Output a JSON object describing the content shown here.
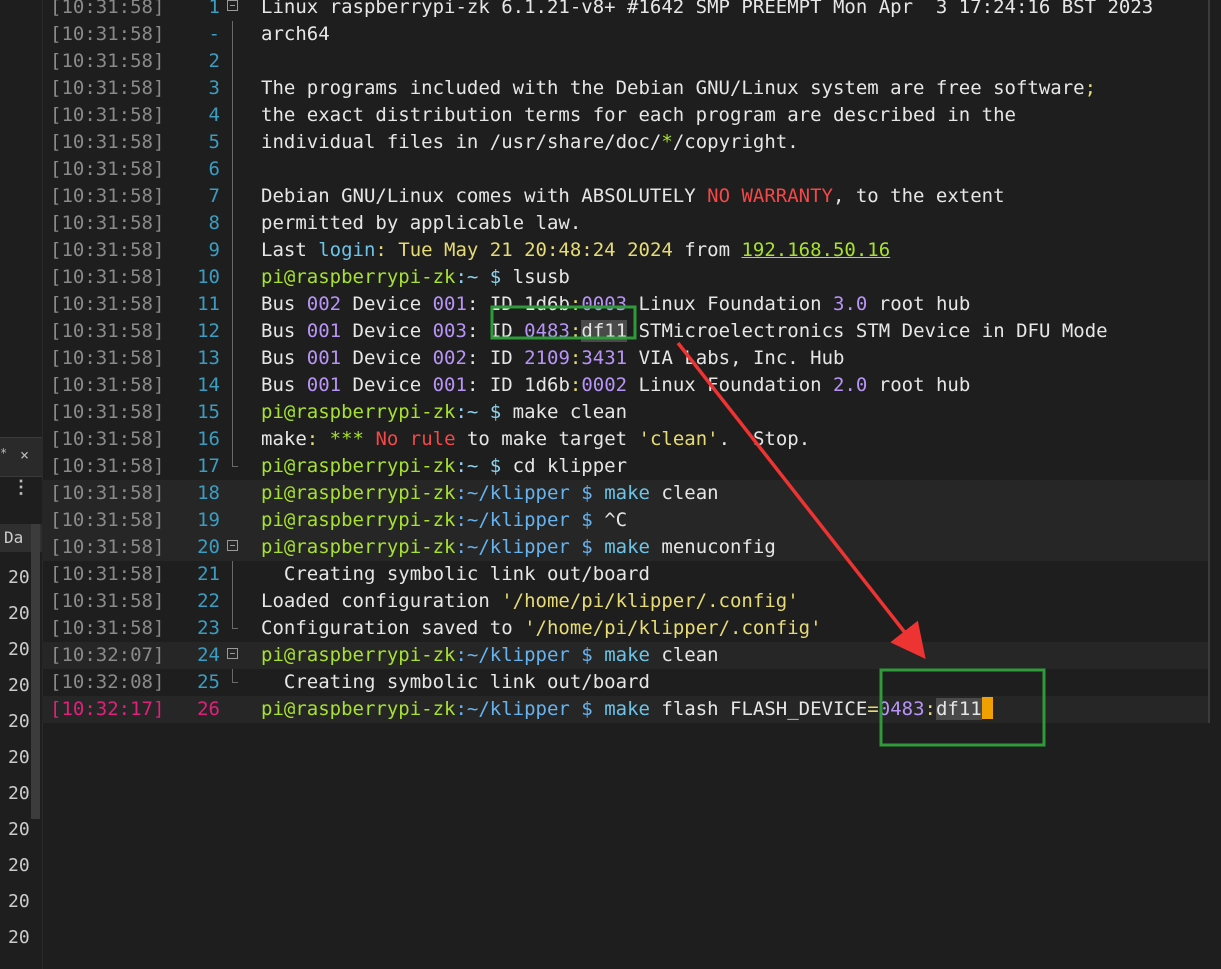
{
  "left_panel": {
    "tab_close": "×",
    "tab_star": "*",
    "menu": "⋮",
    "column_header": "Da",
    "column_values": [
      "20",
      "20",
      "20",
      "20",
      "20",
      "20",
      "20",
      "20",
      "20",
      "20",
      "20"
    ]
  },
  "colors": {
    "prompt_green": "#a6e22e",
    "path_blue": "#66b3f0",
    "command_cyan": "#6cc5e8",
    "number_purple": "#b794f6",
    "string_yellow": "#e6db74",
    "error_red": "#f44747",
    "timestamp_gray": "#8a8a8a",
    "line_number_blue": "#3b9dc2",
    "current_line_pink": "#e0207a",
    "annotation_green": "#2e9a3a",
    "annotation_arrow_red": "#ee3333"
  },
  "lines": [
    {
      "ts": "[10:31:58]",
      "ln": "1",
      "fold": "box",
      "segs": [
        [
          "Linux raspberrypi-zk 6.1.21-v8+ #1642 SMP PREEMPT Mon Apr  3 17:24:16 BST 2023 ",
          "#e6e6e6"
        ]
      ]
    },
    {
      "ts": "[10:31:58]",
      "ln": "-",
      "fold": "bar",
      "segs": [
        [
          "arch64",
          "#e6e6e6"
        ]
      ]
    },
    {
      "ts": "[10:31:58]",
      "ln": "2",
      "fold": "bar",
      "segs": []
    },
    {
      "ts": "[10:31:58]",
      "ln": "3",
      "fold": "bar",
      "segs": [
        [
          "The programs included with the Debian GNU/Linux system are free software",
          "#e6e6e6"
        ],
        [
          ";",
          "#e6db74"
        ]
      ]
    },
    {
      "ts": "[10:31:58]",
      "ln": "4",
      "fold": "bar",
      "segs": [
        [
          "the exact distribution terms for each program are described in the",
          "#e6e6e6"
        ]
      ]
    },
    {
      "ts": "[10:31:58]",
      "ln": "5",
      "fold": "bar",
      "segs": [
        [
          "individual files in /usr/share/doc/",
          "#e6e6e6"
        ],
        [
          "*",
          "#a6e22e"
        ],
        [
          "/copyright.",
          "#e6e6e6"
        ]
      ]
    },
    {
      "ts": "[10:31:58]",
      "ln": "6",
      "fold": "bar",
      "segs": []
    },
    {
      "ts": "[10:31:58]",
      "ln": "7",
      "fold": "bar",
      "segs": [
        [
          "Debian GNU/Linux comes with ABSOLUTELY ",
          "#e6e6e6"
        ],
        [
          "NO WARRANTY",
          "#f44747"
        ],
        [
          ", to the extent",
          "#e6e6e6"
        ]
      ]
    },
    {
      "ts": "[10:31:58]",
      "ln": "8",
      "fold": "bar",
      "segs": [
        [
          "permitted by applicable law.",
          "#e6e6e6"
        ]
      ]
    },
    {
      "ts": "[10:31:58]",
      "ln": "9",
      "fold": "bar",
      "segs": [
        [
          "Last ",
          "#e6e6e6"
        ],
        [
          "login",
          "#6cc5e8"
        ],
        [
          ": Tue May 21 20:48:24 2024 ",
          "#e6db74"
        ],
        [
          "from ",
          "#e6e6e6"
        ],
        [
          "192.168.50.16",
          "#a6e22e",
          "u"
        ]
      ]
    },
    {
      "ts": "[10:31:58]",
      "ln": "10",
      "fold": "bar",
      "segs": [
        [
          "pi@raspberrypi-zk",
          "#a6e22e"
        ],
        [
          ":~ $ ",
          "#8fd3f0"
        ],
        [
          "lsusb",
          "#e6e6e6"
        ]
      ]
    },
    {
      "ts": "[10:31:58]",
      "ln": "11",
      "fold": "bar",
      "segs": [
        [
          "Bus ",
          "#e6e6e6"
        ],
        [
          "002",
          "#b794f6"
        ],
        [
          " Device ",
          "#e6e6e6"
        ],
        [
          "001",
          "#b794f6"
        ],
        [
          ": ID 1d6b",
          "#e6e6e6"
        ],
        [
          ":",
          "#e6db74"
        ],
        [
          "0003",
          "#b794f6"
        ],
        [
          " Linux Foundation ",
          "#e6e6e6"
        ],
        [
          "3.0",
          "#b794f6"
        ],
        [
          " root hub",
          "#e6e6e6"
        ]
      ]
    },
    {
      "ts": "[10:31:58]",
      "ln": "12",
      "fold": "bar",
      "segs": [
        [
          "Bus ",
          "#e6e6e6"
        ],
        [
          "001",
          "#b794f6"
        ],
        [
          " Device ",
          "#e6e6e6"
        ],
        [
          "003",
          "#b794f6"
        ],
        [
          ": ",
          "#e6e6e6"
        ],
        [
          "ID ",
          "#e6e6e6"
        ],
        [
          "0483",
          "#b794f6"
        ],
        [
          ":",
          "#e6db74"
        ],
        [
          "df11",
          "#e6e6e6",
          "sel"
        ],
        [
          " STMicroelectronics STM Device in DFU Mode",
          "#e6e6e6"
        ]
      ]
    },
    {
      "ts": "[10:31:58]",
      "ln": "13",
      "fold": "bar",
      "segs": [
        [
          "Bus ",
          "#e6e6e6"
        ],
        [
          "001",
          "#b794f6"
        ],
        [
          " Device ",
          "#e6e6e6"
        ],
        [
          "002",
          "#b794f6"
        ],
        [
          ": ID ",
          "#e6e6e6"
        ],
        [
          "2109",
          "#b794f6"
        ],
        [
          ":",
          "#e6db74"
        ],
        [
          "3431",
          "#b794f6"
        ],
        [
          " VIA Labs, Inc. Hub",
          "#e6e6e6"
        ]
      ]
    },
    {
      "ts": "[10:31:58]",
      "ln": "14",
      "fold": "bar",
      "segs": [
        [
          "Bus ",
          "#e6e6e6"
        ],
        [
          "001",
          "#b794f6"
        ],
        [
          " Device ",
          "#e6e6e6"
        ],
        [
          "001",
          "#b794f6"
        ],
        [
          ": ID 1d6b",
          "#e6e6e6"
        ],
        [
          ":",
          "#e6db74"
        ],
        [
          "0002",
          "#b794f6"
        ],
        [
          " Linux Foundation ",
          "#e6e6e6"
        ],
        [
          "2.0",
          "#b794f6"
        ],
        [
          " root hub",
          "#e6e6e6"
        ]
      ]
    },
    {
      "ts": "[10:31:58]",
      "ln": "15",
      "fold": "bar",
      "segs": [
        [
          "pi@raspberrypi-zk",
          "#a6e22e"
        ],
        [
          ":~ $ ",
          "#8fd3f0"
        ],
        [
          "make clean",
          "#e6e6e6"
        ]
      ]
    },
    {
      "ts": "[10:31:58]",
      "ln": "16",
      "fold": "bar",
      "segs": [
        [
          "make",
          "#e6e6e6"
        ],
        [
          ": ",
          "#e6db74"
        ],
        [
          "***",
          "#a6e22e"
        ],
        [
          " ",
          "#e6e6e6"
        ],
        [
          "No rule",
          "#f44747"
        ],
        [
          " to make target ",
          "#e6e6e6"
        ],
        [
          "'clean'",
          "#e6db74"
        ],
        [
          ".  Stop.",
          "#e6e6e6"
        ]
      ]
    },
    {
      "ts": "[10:31:58]",
      "ln": "17",
      "fold": "end",
      "segs": [
        [
          "pi@raspberrypi-zk",
          "#a6e22e"
        ],
        [
          ":~ $ ",
          "#8fd3f0"
        ],
        [
          "cd klipper",
          "#e6e6e6"
        ]
      ]
    },
    {
      "ts": "[10:31:58]",
      "ln": "18",
      "fold": "",
      "hl": true,
      "segs": [
        [
          "pi@raspberrypi-zk",
          "#a6e22e"
        ],
        [
          ":~/klipper $ ",
          "#66b3f0"
        ],
        [
          "make",
          "#6cc5e8"
        ],
        [
          " clean",
          "#e6e6e6"
        ]
      ]
    },
    {
      "ts": "[10:31:58]",
      "ln": "19",
      "fold": "",
      "hl": true,
      "segs": [
        [
          "pi@raspberrypi-zk",
          "#a6e22e"
        ],
        [
          ":~/klipper $ ",
          "#66b3f0"
        ],
        [
          "^C",
          "#e6e6e6"
        ]
      ]
    },
    {
      "ts": "[10:31:58]",
      "ln": "20",
      "fold": "box",
      "hl": true,
      "segs": [
        [
          "pi@raspberrypi-zk",
          "#a6e22e"
        ],
        [
          ":~/klipper $ ",
          "#66b3f0"
        ],
        [
          "make",
          "#6cc5e8"
        ],
        [
          " menuconfig",
          "#e6e6e6"
        ]
      ]
    },
    {
      "ts": "[10:31:58]",
      "ln": "21",
      "fold": "bar",
      "segs": [
        [
          "  Creating symbolic link out/board",
          "#e6e6e6"
        ]
      ]
    },
    {
      "ts": "[10:31:58]",
      "ln": "22",
      "fold": "bar",
      "segs": [
        [
          "Loaded configuration ",
          "#e6e6e6"
        ],
        [
          "'/home/pi/klipper/.config'",
          "#e6db74"
        ]
      ]
    },
    {
      "ts": "[10:31:58]",
      "ln": "23",
      "fold": "end",
      "segs": [
        [
          "Configuration saved to ",
          "#e6e6e6"
        ],
        [
          "'/home/pi/klipper/.config'",
          "#e6db74"
        ]
      ]
    },
    {
      "ts": "[10:32:07]",
      "ln": "24",
      "fold": "box",
      "hl": true,
      "segs": [
        [
          "pi@raspberrypi-zk",
          "#a6e22e"
        ],
        [
          ":~/klipper $ ",
          "#66b3f0"
        ],
        [
          "make",
          "#6cc5e8"
        ],
        [
          " clean",
          "#e6e6e6"
        ]
      ]
    },
    {
      "ts": "[10:32:08]",
      "ln": "25",
      "fold": "end",
      "segs": [
        [
          "  Creating symbolic link out/board",
          "#e6e6e6"
        ]
      ]
    },
    {
      "ts": "[10:32:17]",
      "ln": "26",
      "fold": "",
      "hl": true,
      "cur": true,
      "segs": [
        [
          "pi@raspberrypi-zk",
          "#a6e22e"
        ],
        [
          ":~/klipper $ ",
          "#66b3f0"
        ],
        [
          "make",
          "#6cc5e8"
        ],
        [
          " flash FLASH_DEVICE",
          "#e6e6e6"
        ],
        [
          "=",
          "#e6db74"
        ],
        [
          "0483",
          "#b794f6"
        ],
        [
          ":",
          "#e6db74"
        ],
        [
          "df11",
          "#e6e6e6",
          "sel"
        ]
      ]
    }
  ]
}
